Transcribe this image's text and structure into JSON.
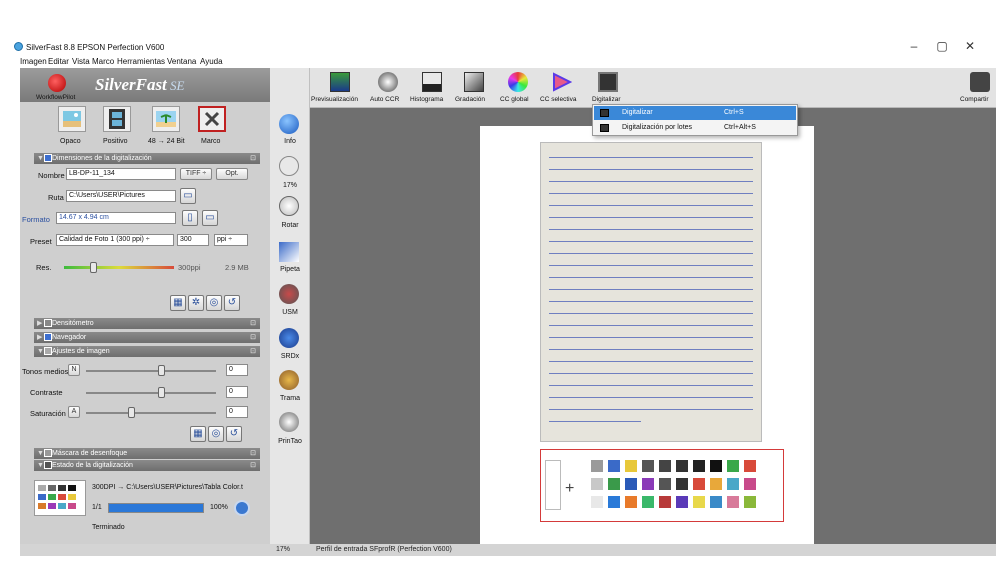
{
  "window": {
    "title": "SilverFast 8.8 EPSON Perfection V600",
    "min": "–",
    "max": "▢",
    "close": "✕"
  },
  "menu": [
    "Imagen",
    "Editar",
    "Vista",
    "Marco",
    "Herramientas",
    "Ventana",
    "Ayuda"
  ],
  "brand": {
    "name": "SilverFast",
    "edition": "SE",
    "workflow": "WorkflowPilot"
  },
  "modes": [
    {
      "label": "Opaco"
    },
    {
      "label": "Positivo"
    },
    {
      "label": "48 → 24 Bit"
    },
    {
      "label": "Marco"
    }
  ],
  "sections": {
    "dimensions": "Dimensiones de la digitalización",
    "densitometer": "Densitómetro",
    "navigator": "Navegador",
    "adjust": "Ajustes de imagen",
    "unsharp": "Máscara de desenfoque",
    "status": "Estado de la digitalización"
  },
  "dimensions": {
    "name_label": "Nombre",
    "name_value": "LB-DP-11_134",
    "format_value": "TIFF ÷",
    "opt": "Opt.",
    "path_label": "Ruta",
    "path_value": "C:\\Users\\USER\\Pictures",
    "formato_label": "Formato",
    "formato_value": "14.67 x 4.94 cm",
    "preset_label": "Preset",
    "preset_value": "Calidad de Foto 1 (300 ppi) ÷",
    "dpi_value": "300",
    "dpi_unit": "ppi ÷",
    "res_label": "Res.",
    "res_value": "300ppi",
    "size_value": "2.9 MB"
  },
  "adjust": {
    "midtones_label": "Tonos medios",
    "midtones_btn": "N",
    "midtones_value": "0",
    "contrast_label": "Contraste",
    "contrast_value": "0",
    "saturation_label": "Saturación",
    "saturation_btn": "A",
    "saturation_value": "0"
  },
  "status": {
    "line1": "300DPI → C:\\Users\\USER\\Pictures\\Tabla Color.t",
    "count": "1/1",
    "percent": "100%",
    "progress": 1.0,
    "done": "Terminado"
  },
  "toolbar": [
    "Previsualización",
    "Auto CCR",
    "Histograma",
    "Gradación",
    "CC global",
    "CC selectiva",
    "Digitalizar",
    "Compartir"
  ],
  "sidetools": [
    "Info",
    "17%",
    "Rotar",
    "Pipeta",
    "USM",
    "SRDx",
    "Trama",
    "PrinTao"
  ],
  "dropdown": [
    {
      "label": "Digitalizar",
      "shortcut": "Ctrl+S"
    },
    {
      "label": "Digitalización por lotes",
      "shortcut": "Ctrl+Alt+S"
    }
  ],
  "statusbar": {
    "zoom": "17%",
    "profile": "Perfil de entrada SFprofR (Perfection V600)"
  },
  "colors": {
    "accent": "#3a88d8",
    "frame_red": "#d43a3a"
  }
}
